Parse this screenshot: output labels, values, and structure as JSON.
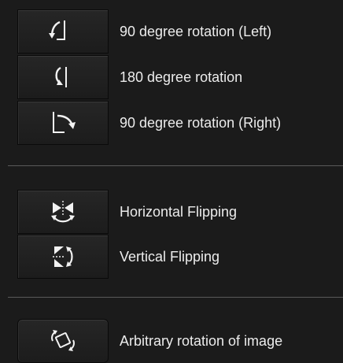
{
  "rotation": {
    "rotate_left": {
      "label": "90 degree rotation (Left)",
      "icon": "rotate-left-icon"
    },
    "rotate_180": {
      "label": "180 degree rotation",
      "icon": "rotate-180-icon"
    },
    "rotate_right": {
      "label": "90 degree rotation (Right)",
      "icon": "rotate-right-icon"
    }
  },
  "flipping": {
    "horizontal": {
      "label": "Horizontal Flipping",
      "icon": "flip-horizontal-icon"
    },
    "vertical": {
      "label": "Vertical Flipping",
      "icon": "flip-vertical-icon"
    }
  },
  "arbitrary": {
    "label": "Arbitrary rotation of image",
    "icon": "arbitrary-rotation-icon"
  },
  "colors": {
    "background": "#1b1b1b",
    "button": "#232323",
    "text": "#ececec",
    "separator": "#5a5a5a"
  }
}
